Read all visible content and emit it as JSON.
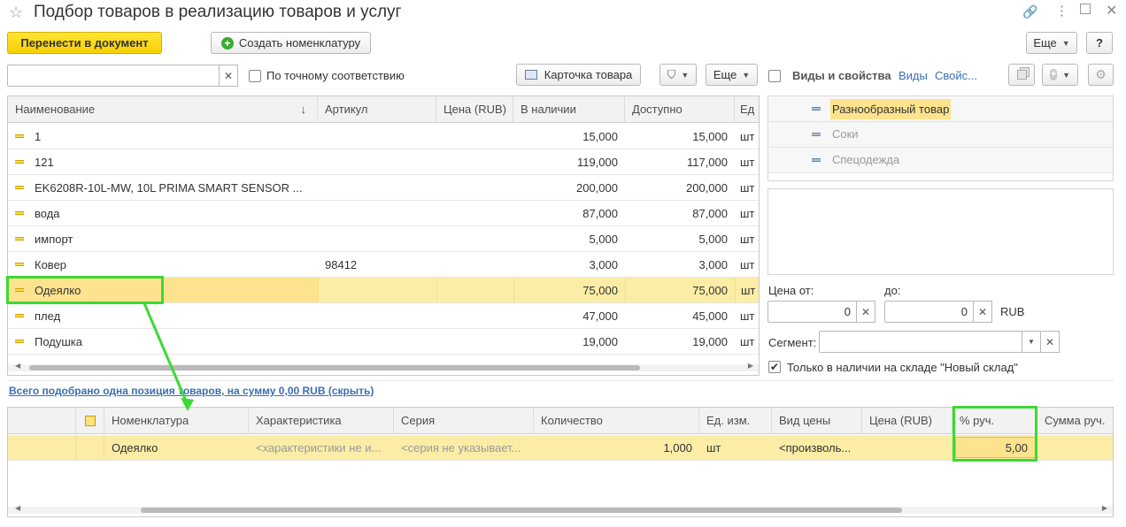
{
  "window": {
    "title": "Подбор товаров в реализацию товаров и услуг"
  },
  "toolbar": {
    "transfer_label": "Перенести в документ",
    "create_label": "Создать номенклатуру",
    "more_label": "Еще",
    "help_label": "?"
  },
  "search": {
    "value": "",
    "exact_label": "По точному соответствию",
    "card_label": "Карточка товара",
    "more_label": "Еще"
  },
  "goods_table": {
    "columns": [
      "Наименование",
      "Артикул",
      "Цена (RUB)",
      "В наличии",
      "Доступно",
      "Ед"
    ],
    "rows": [
      {
        "name": "1",
        "article": "",
        "price": "",
        "in_stock": "15,000",
        "available": "15,000",
        "unit": "шт"
      },
      {
        "name": "121",
        "article": "",
        "price": "",
        "in_stock": "119,000",
        "available": "117,000",
        "unit": "шт"
      },
      {
        "name": "EK6208R-10L-MW, 10L PRIMA SMART SENSOR ...",
        "article": "",
        "price": "",
        "in_stock": "200,000",
        "available": "200,000",
        "unit": "шт"
      },
      {
        "name": "вода",
        "article": "",
        "price": "",
        "in_stock": "87,000",
        "available": "87,000",
        "unit": "шт"
      },
      {
        "name": "импорт",
        "article": "",
        "price": "",
        "in_stock": "5,000",
        "available": "5,000",
        "unit": "шт"
      },
      {
        "name": "Ковер",
        "article": "98412",
        "price": "",
        "in_stock": "3,000",
        "available": "3,000",
        "unit": "шт"
      },
      {
        "name": "Одеялко",
        "article": "",
        "price": "",
        "in_stock": "75,000",
        "available": "75,000",
        "unit": "шт"
      },
      {
        "name": "плед",
        "article": "",
        "price": "",
        "in_stock": "47,000",
        "available": "45,000",
        "unit": "шт"
      },
      {
        "name": "Подушка",
        "article": "",
        "price": "",
        "in_stock": "19,000",
        "available": "19,000",
        "unit": "шт"
      }
    ],
    "sort_indicator": "↓"
  },
  "properties_panel": {
    "title": "Виды и свойства",
    "link_kinds": "Виды",
    "link_props": "Свойс...",
    "items": [
      "Разнообразный товар",
      "Соки",
      "Спецодежда"
    ]
  },
  "filters": {
    "price_from_label": "Цена от:",
    "price_from_value": "0",
    "price_to_label": "до:",
    "price_to_value": "0",
    "currency": "RUB",
    "segment_label": "Сегмент:",
    "segment_value": "",
    "in_stock_label": "Только в наличии на складе \"Новый склад\"",
    "in_stock_checked": true
  },
  "summary": {
    "text": "Всего подобрано одна позиция товаров, на сумму 0,00 RUB (скрыть)"
  },
  "selected_table": {
    "columns": [
      "Номенклатура",
      "Характеристика",
      "Серия",
      "Количество",
      "Ед. изм.",
      "Вид цены",
      "Цена (RUB)",
      "% руч.",
      "Сумма руч."
    ],
    "rows": [
      {
        "item": "Одеялко",
        "characteristic": "<характеристики не и...",
        "series": "<серия не указывает...",
        "quantity": "1,000",
        "unit": "шт",
        "price_kind": "<произволь...",
        "price": "",
        "manual_pct": "5,00",
        "manual_sum": ""
      }
    ]
  },
  "colors": {
    "accent_yellow": "#f7d000",
    "selection": "#fbeda6",
    "highlight_green": "#3dd934",
    "link": "#3a6fb0"
  }
}
